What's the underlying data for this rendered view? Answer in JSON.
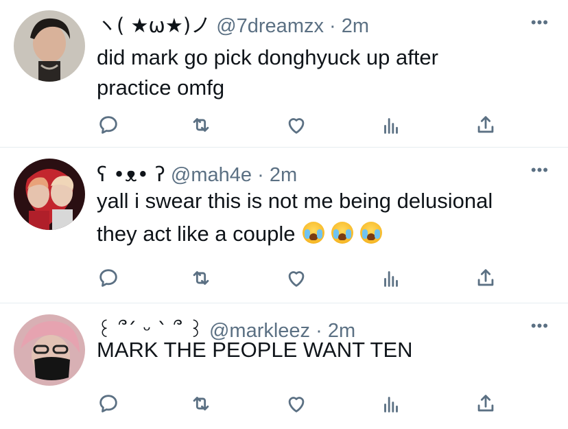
{
  "tweets": [
    {
      "display_name": "ヽ( ★ω★)ノ",
      "handle": "@7dreamzx",
      "separator": "·",
      "time": "2m",
      "text": "did mark go pick donghyuck up after\npractice omfg",
      "emoji_count": 0
    },
    {
      "display_name": "ʕ •ᴥ• ʔ",
      "handle": "@mah4e",
      "separator": "·",
      "time": "2m",
      "text": "yall i swear this is not me being delusional\nthey act like a couple",
      "emoji_count": 3
    },
    {
      "display_name": "꒰ ՞´ ᵕ ` ՞ ꒱",
      "handle": "@markleez",
      "separator": "·",
      "time": "2m",
      "text": "MARK THE PEOPLE WANT TEN",
      "emoji_count": 0
    }
  ],
  "more_label": "•••",
  "icons": [
    "reply-icon",
    "retweet-icon",
    "like-icon",
    "stats-icon",
    "share-icon"
  ],
  "colors": {
    "text": "#0f1419",
    "secondary": "#5b7083",
    "divider": "#e6ecf0"
  }
}
